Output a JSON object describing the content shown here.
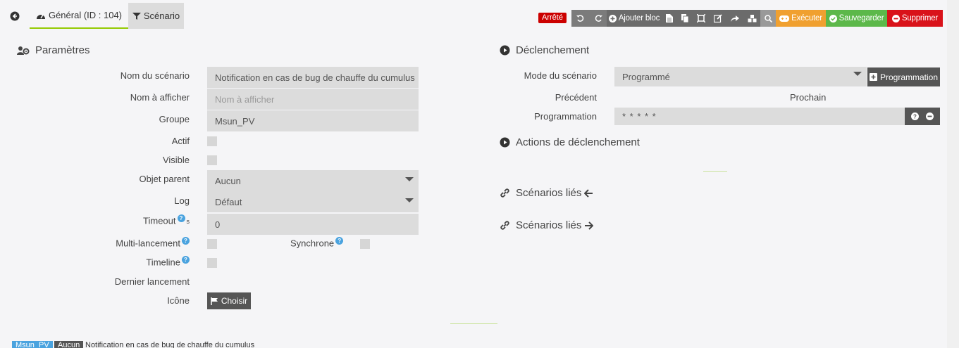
{
  "tabs": {
    "general": "Général (ID : 104)",
    "scenario": "Scénario"
  },
  "toolbar": {
    "status": "Arrêté",
    "add_block": "Ajouter bloc",
    "execute": "Exécuter",
    "save": "Sauvegarder",
    "delete": "Supprimer"
  },
  "params": {
    "title": "Paramètres",
    "name_label": "Nom du scénario",
    "name_value": "Notification en cas de bug de chauffe du cumulus",
    "display_label": "Nom à afficher",
    "display_placeholder": "Nom à afficher",
    "group_label": "Groupe",
    "group_value": "Msun_PV",
    "active_label": "Actif",
    "visible_label": "Visible",
    "parent_label": "Objet parent",
    "parent_value": "Aucun",
    "log_label": "Log",
    "log_value": "Défaut",
    "timeout_label": "Timeout",
    "timeout_unit": "s",
    "timeout_value": "0",
    "multi_label": "Multi-lancement",
    "sync_label": "Synchrone",
    "timeline_label": "Timeline",
    "last_run_label": "Dernier lancement",
    "icon_label": "Icône",
    "choose_button": "Choisir"
  },
  "trigger": {
    "title": "Déclenchement",
    "mode_label": "Mode du scénario",
    "mode_value": "Programmé",
    "programming_button": "Programmation",
    "previous_label": "Précédent",
    "next_label": "Prochain",
    "programming_label": "Programmation",
    "programming_value": "* * * * *",
    "actions_title": "Actions de déclenchement",
    "linked_in_title": "Scénarios liés",
    "linked_out_title": "Scénarios liés"
  },
  "footer": {
    "group": "Msun_PV",
    "parent": "Aucun",
    "name": "Notification en cas de bug de chauffe du cumulus"
  },
  "colors": {
    "accent": "#94ca02",
    "stopped": "#cc0000",
    "execute": "#f0a030",
    "save": "#5cb84a",
    "delete": "#d9121a",
    "footer_group": "#4aa3df",
    "footer_parent": "#555555"
  }
}
